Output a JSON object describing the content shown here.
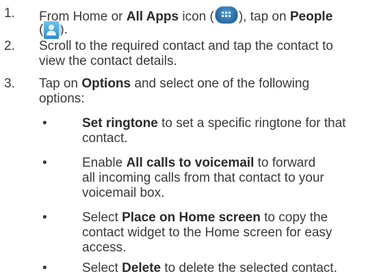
{
  "steps": [
    {
      "number": "1.",
      "line1_pre": "From Home or ",
      "line1_b1": "All Apps",
      "line1_mid": " icon (",
      "line1_mid2": "), tap on ",
      "line1_b2": "People",
      "line2_pre": "(",
      "line2_post": ")."
    },
    {
      "number": "2.",
      "line1": "Scroll to the required contact and tap the contact to",
      "line2": "view the contact details."
    },
    {
      "number": "3.",
      "line1_pre": "Tap on ",
      "line1_b": "Options",
      "line1_post": " and select one of the following",
      "line2": "options:"
    }
  ],
  "bullet_char": "•",
  "options": [
    {
      "l1_b": "Set ringtone",
      "l1_post": " to set a specific ringtone for that",
      "l2": "contact."
    },
    {
      "l1_pre": "Enable ",
      "l1_b": "All calls to voicemail",
      "l1_post": " to forward",
      "l2": "all incoming calls from that contact to your",
      "l3": "voicemail box."
    },
    {
      "l1_pre": "Select ",
      "l1_b": "Place on Home screen",
      "l1_post": " to copy the",
      "l2": "contact widget to the Home screen for easy",
      "l3": "access."
    },
    {
      "l1_pre": "Select ",
      "l1_b": "Delete",
      "l1_post": " to delete the selected contact."
    }
  ]
}
